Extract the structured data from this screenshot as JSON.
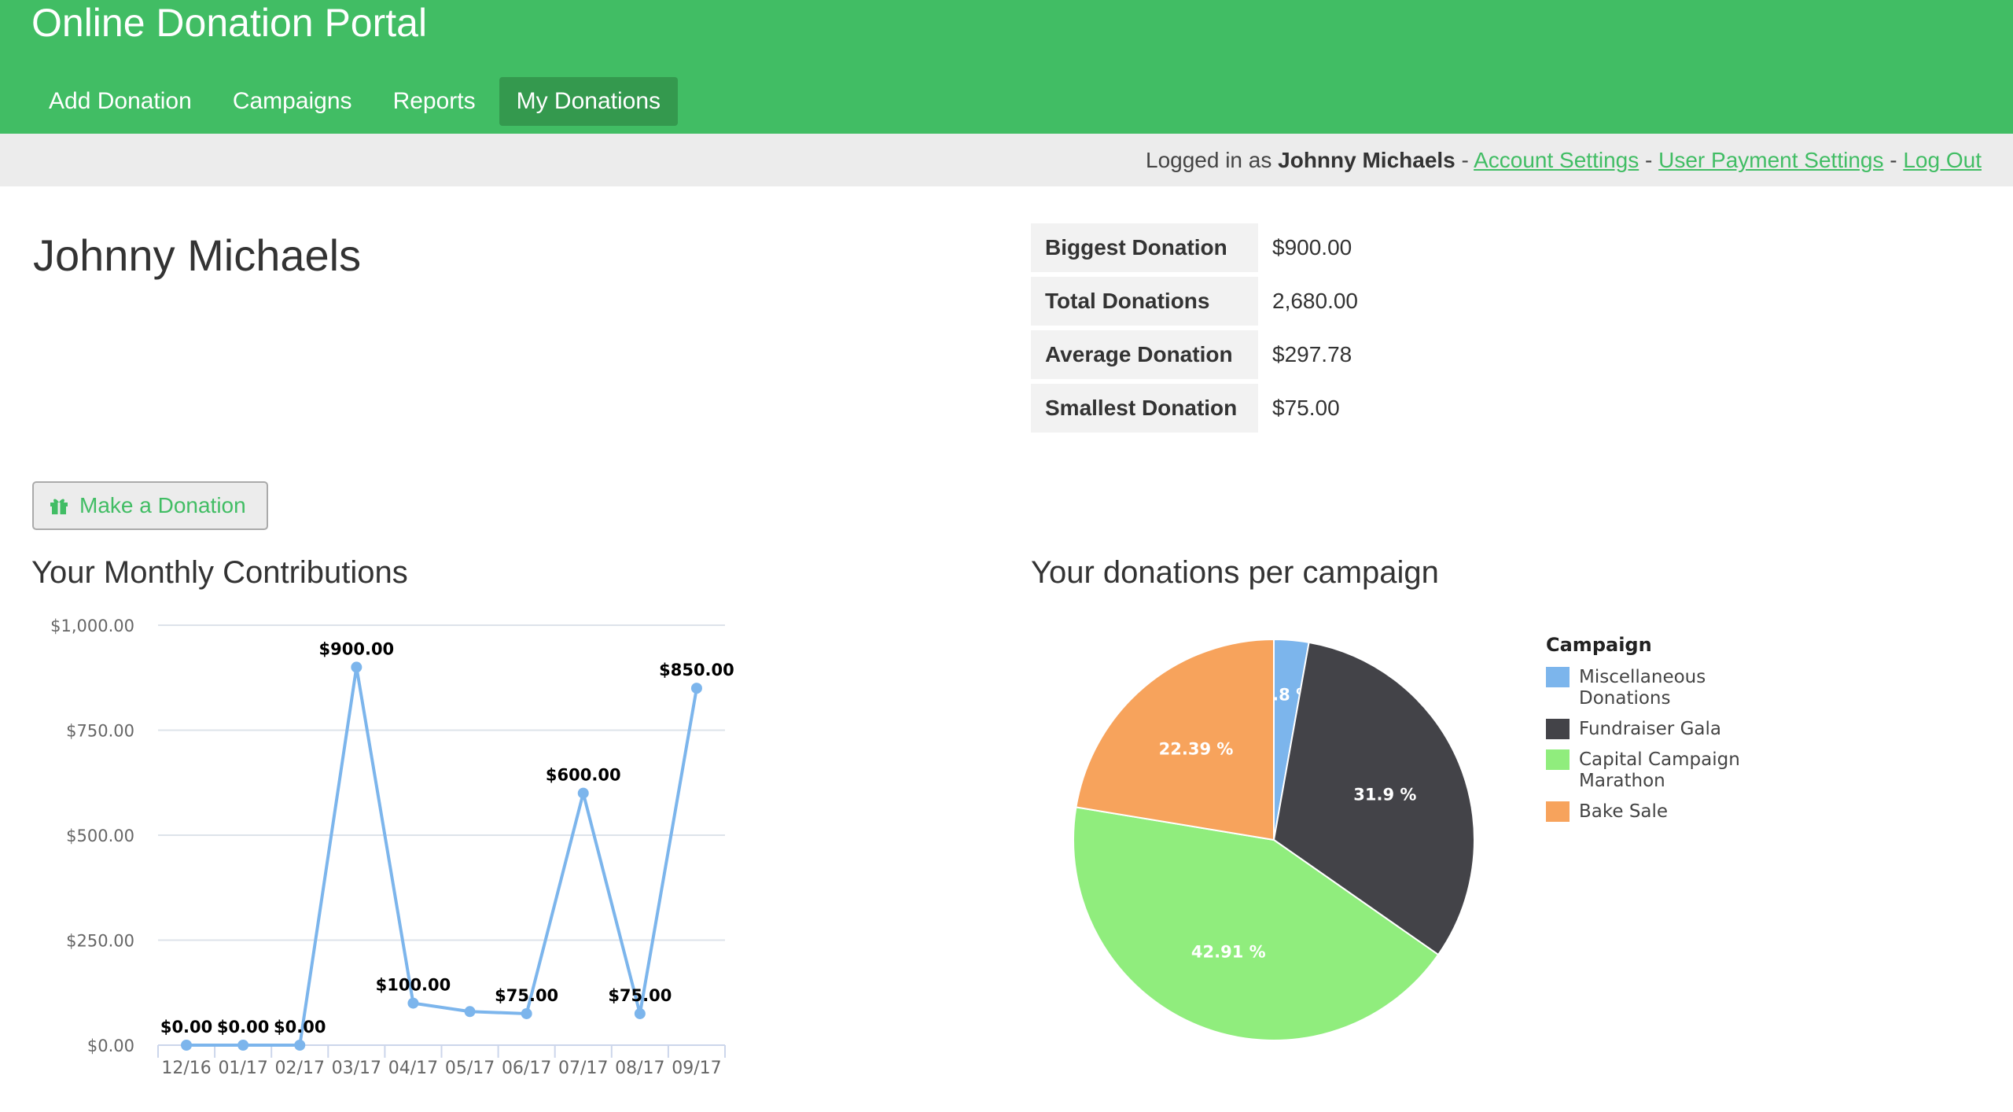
{
  "header": {
    "title": "Online Donation Portal",
    "nav": [
      {
        "label": "Add Donation",
        "active": false
      },
      {
        "label": "Campaigns",
        "active": false
      },
      {
        "label": "Reports",
        "active": false
      },
      {
        "label": "My Donations",
        "active": true
      }
    ]
  },
  "userbar": {
    "prefix": "Logged in as",
    "user": "Johnny Michaels",
    "sep": "-",
    "links": [
      "Account Settings",
      "User Payment Settings",
      "Log Out"
    ]
  },
  "profile": {
    "name": "Johnny Michaels"
  },
  "stats": [
    {
      "label": "Biggest Donation",
      "value": "$900.00"
    },
    {
      "label": "Total Donations",
      "value": "2,680.00"
    },
    {
      "label": "Average Donation",
      "value": "$297.78"
    },
    {
      "label": "Smallest Donation",
      "value": "$75.00"
    }
  ],
  "donate_button": {
    "label": "Make a Donation",
    "icon": "gift-icon"
  },
  "colors": {
    "brand": "#41bd64",
    "active_nav": "#34994e"
  },
  "chart_data": [
    {
      "type": "line",
      "title": "Your Monthly Contributions",
      "categories": [
        "12/16",
        "01/17",
        "02/17",
        "03/17",
        "04/17",
        "05/17",
        "06/17",
        "07/17",
        "08/17",
        "09/17"
      ],
      "values": [
        0,
        0,
        0,
        900,
        100,
        80,
        75,
        600,
        75,
        850
      ],
      "data_labels": [
        "$0.00",
        "$0.00",
        "$0.00",
        "$900.00",
        "$100.00",
        null,
        "$75.00",
        "$600.00",
        "$75.00",
        "$850.00"
      ],
      "yticks": [
        "$0.00",
        "$250.00",
        "$500.00",
        "$750.00",
        "$1,000.00"
      ],
      "ylim": [
        0,
        1000
      ],
      "grid": true,
      "color": "#7cb5ec"
    },
    {
      "type": "pie",
      "title": "Your donations per campaign",
      "legend_title": "Campaign",
      "legend_placement": "right",
      "slices": [
        {
          "name": "Miscellaneous Donations",
          "value": 2.8,
          "label": "2.8 %",
          "color": "#7cb5ec"
        },
        {
          "name": "Fundraiser Gala",
          "value": 31.9,
          "label": "31.9 %",
          "color": "#434348"
        },
        {
          "name": "Capital Campaign Marathon",
          "value": 42.91,
          "label": "42.91 %",
          "color": "#90ed7d"
        },
        {
          "name": "Bake Sale",
          "value": 22.39,
          "label": "22.39 %",
          "color": "#f7a35c"
        }
      ]
    }
  ]
}
